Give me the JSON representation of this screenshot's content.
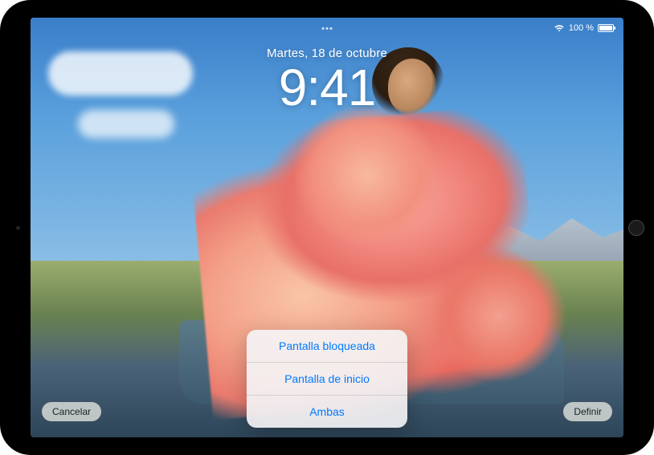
{
  "status_bar": {
    "battery_text": "100 %"
  },
  "lockscreen": {
    "date": "Martes, 18 de octubre",
    "time": "9:41"
  },
  "buttons": {
    "cancel": "Cancelar",
    "set": "Definir"
  },
  "action_sheet": {
    "options": [
      "Pantalla bloqueada",
      "Pantalla de inicio",
      "Ambas"
    ]
  }
}
